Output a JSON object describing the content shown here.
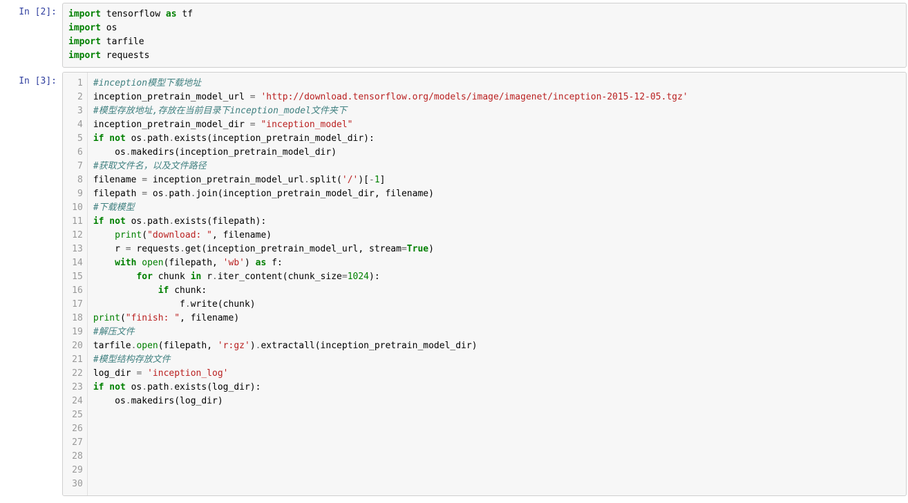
{
  "cells": [
    {
      "prompt": "In [2]:",
      "gutter": false,
      "lines": [
        [
          [
            "k",
            "import"
          ],
          [
            "",
            " "
          ],
          [
            "nn",
            "tensorflow"
          ],
          [
            "",
            " "
          ],
          [
            "k",
            "as"
          ],
          [
            "",
            " "
          ],
          [
            "nn",
            "tf"
          ]
        ],
        [
          [
            "k",
            "import"
          ],
          [
            "",
            " "
          ],
          [
            "nn",
            "os"
          ]
        ],
        [
          [
            "k",
            "import"
          ],
          [
            "",
            " "
          ],
          [
            "nn",
            "tarfile"
          ]
        ],
        [
          [
            "k",
            "import"
          ],
          [
            "",
            " "
          ],
          [
            "nn",
            "requests"
          ]
        ]
      ]
    },
    {
      "prompt": "In [3]:",
      "gutter": true,
      "lines": [
        [
          [
            "c",
            "#inception模型下载地址"
          ]
        ],
        [
          [
            "",
            "inception_pretrain_model_url "
          ],
          [
            "o",
            "="
          ],
          [
            "",
            " "
          ],
          [
            "s",
            "'http://download.tensorflow.org/models/image/imagenet/inception-2015-12-05.tgz'"
          ]
        ],
        [
          [
            "",
            ""
          ]
        ],
        [
          [
            "c",
            "#模型存放地址,存放在当前目录下inception_model文件夹下"
          ]
        ],
        [
          [
            "",
            "inception_pretrain_model_dir "
          ],
          [
            "o",
            "="
          ],
          [
            "",
            " "
          ],
          [
            "s",
            "\"inception_model\""
          ]
        ],
        [
          [
            "k",
            "if"
          ],
          [
            "",
            " "
          ],
          [
            "k",
            "not"
          ],
          [
            "",
            " os"
          ],
          [
            "o",
            "."
          ],
          [
            "",
            "path"
          ],
          [
            "o",
            "."
          ],
          [
            "",
            "exists(inception_pretrain_model_dir):"
          ]
        ],
        [
          [
            "",
            "    os"
          ],
          [
            "o",
            "."
          ],
          [
            "",
            "makedirs(inception_pretrain_model_dir)"
          ]
        ],
        [
          [
            "",
            ""
          ]
        ],
        [
          [
            "c",
            "#获取文件名，以及文件路径"
          ]
        ],
        [
          [
            "",
            "filename "
          ],
          [
            "o",
            "="
          ],
          [
            "",
            " inception_pretrain_model_url"
          ],
          [
            "o",
            "."
          ],
          [
            "",
            "split("
          ],
          [
            "s",
            "'/'"
          ],
          [
            "",
            ")["
          ],
          [
            "o",
            "-"
          ],
          [
            "m",
            "1"
          ],
          [
            "",
            "]"
          ]
        ],
        [
          [
            "",
            "filepath "
          ],
          [
            "o",
            "="
          ],
          [
            "",
            " os"
          ],
          [
            "o",
            "."
          ],
          [
            "",
            "path"
          ],
          [
            "o",
            "."
          ],
          [
            "",
            "join(inception_pretrain_model_dir, filename)"
          ]
        ],
        [
          [
            "",
            ""
          ]
        ],
        [
          [
            "c",
            "#下载模型"
          ]
        ],
        [
          [
            "k",
            "if"
          ],
          [
            "",
            " "
          ],
          [
            "k",
            "not"
          ],
          [
            "",
            " os"
          ],
          [
            "o",
            "."
          ],
          [
            "",
            "path"
          ],
          [
            "o",
            "."
          ],
          [
            "",
            "exists(filepath):"
          ]
        ],
        [
          [
            "",
            "    "
          ],
          [
            "nb",
            "print"
          ],
          [
            "",
            "("
          ],
          [
            "s",
            "\"download: \""
          ],
          [
            "",
            ", filename)"
          ]
        ],
        [
          [
            "",
            "    r "
          ],
          [
            "o",
            "="
          ],
          [
            "",
            " requests"
          ],
          [
            "o",
            "."
          ],
          [
            "",
            "get(inception_pretrain_model_url, stream"
          ],
          [
            "o",
            "="
          ],
          [
            "kc",
            "True"
          ],
          [
            "",
            ")"
          ]
        ],
        [
          [
            "",
            "    "
          ],
          [
            "k",
            "with"
          ],
          [
            "",
            " "
          ],
          [
            "nb",
            "open"
          ],
          [
            "",
            "(filepath, "
          ],
          [
            "s",
            "'wb'"
          ],
          [
            "",
            ") "
          ],
          [
            "k",
            "as"
          ],
          [
            "",
            " f:"
          ]
        ],
        [
          [
            "",
            "        "
          ],
          [
            "k",
            "for"
          ],
          [
            "",
            " chunk "
          ],
          [
            "k",
            "in"
          ],
          [
            "",
            " r"
          ],
          [
            "o",
            "."
          ],
          [
            "",
            "iter_content(chunk_size"
          ],
          [
            "o",
            "="
          ],
          [
            "m",
            "1024"
          ],
          [
            "",
            "):"
          ]
        ],
        [
          [
            "",
            "            "
          ],
          [
            "k",
            "if"
          ],
          [
            "",
            " chunk:"
          ]
        ],
        [
          [
            "",
            "                f"
          ],
          [
            "o",
            "."
          ],
          [
            "",
            "write(chunk)"
          ]
        ],
        [
          [
            "nb",
            "print"
          ],
          [
            "",
            "("
          ],
          [
            "s",
            "\"finish: \""
          ],
          [
            "",
            ", filename)"
          ]
        ],
        [
          [
            "",
            ""
          ]
        ],
        [
          [
            "c",
            "#解压文件"
          ]
        ],
        [
          [
            "",
            "tarfile"
          ],
          [
            "o",
            "."
          ],
          [
            "nb",
            "open"
          ],
          [
            "",
            "(filepath, "
          ],
          [
            "s",
            "'r:gz'"
          ],
          [
            "",
            ")"
          ],
          [
            "o",
            "."
          ],
          [
            "",
            "extractall(inception_pretrain_model_dir)"
          ]
        ],
        [
          [
            "",
            ""
          ]
        ],
        [
          [
            "c",
            "#模型结构存放文件"
          ]
        ],
        [
          [
            "",
            "log_dir "
          ],
          [
            "o",
            "="
          ],
          [
            "",
            " "
          ],
          [
            "s",
            "'inception_log'"
          ]
        ],
        [
          [
            "k",
            "if"
          ],
          [
            "",
            " "
          ],
          [
            "k",
            "not"
          ],
          [
            "",
            " os"
          ],
          [
            "o",
            "."
          ],
          [
            "",
            "path"
          ],
          [
            "o",
            "."
          ],
          [
            "",
            "exists(log_dir):"
          ]
        ],
        [
          [
            "",
            "    os"
          ],
          [
            "o",
            "."
          ],
          [
            "",
            "makedirs(log_dir)"
          ]
        ],
        [
          [
            "",
            ""
          ]
        ]
      ]
    }
  ]
}
